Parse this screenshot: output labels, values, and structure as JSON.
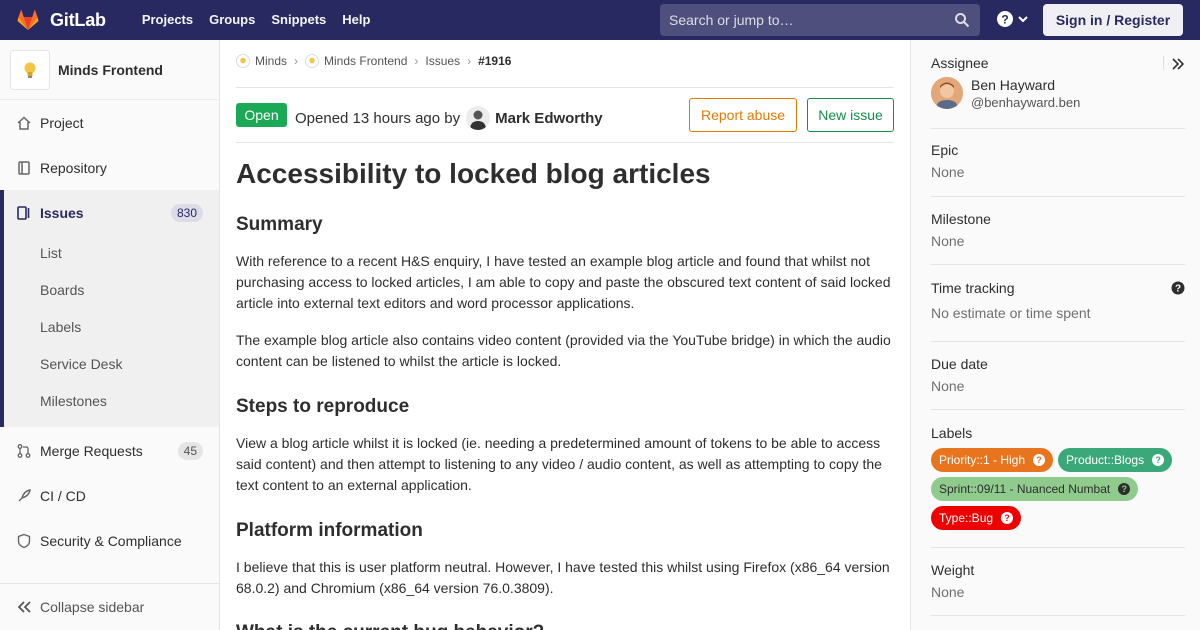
{
  "topbar": {
    "brand": "GitLab",
    "nav": [
      "Projects",
      "Groups",
      "Snippets",
      "Help"
    ],
    "search_placeholder": "Search or jump to…",
    "signin_label": "Sign in / Register",
    "bg_color": "#292961"
  },
  "sidebar": {
    "project_name": "Minds Frontend",
    "items": [
      {
        "label": "Project",
        "icon": "home-icon"
      },
      {
        "label": "Repository",
        "icon": "book-icon"
      },
      {
        "label": "Issues",
        "icon": "issues-icon",
        "count": "830",
        "active": true
      },
      {
        "label": "Merge Requests",
        "icon": "merge-request-icon",
        "count": "45"
      },
      {
        "label": "CI / CD",
        "icon": "rocket-icon"
      },
      {
        "label": "Security & Compliance",
        "icon": "shield-icon"
      }
    ],
    "issues_subitems": [
      "List",
      "Boards",
      "Labels",
      "Service Desk",
      "Milestones"
    ],
    "collapse_label": "Collapse sidebar"
  },
  "breadcrumb": [
    "Minds",
    "Minds Frontend",
    "Issues",
    "#1916"
  ],
  "issue": {
    "status": "Open",
    "opened_text": "Opened 13 hours ago by",
    "author": "Mark Edworthy",
    "report_label": "Report abuse",
    "new_issue_label": "New issue",
    "title": "Accessibility to locked blog articles",
    "sections": [
      {
        "heading": "Summary"
      },
      {
        "heading": "Steps to reproduce"
      },
      {
        "heading": "Platform information"
      },
      {
        "heading": "What is the current bug behavior?"
      }
    ],
    "paragraphs": [
      "With reference to a recent H&S enquiry, I have tested an example blog article and found that whilst not purchasing access to locked articles, I am able to copy and paste the obscured text content of said locked article into external text editors and word processor applications.",
      "The example blog article also contains video content (provided via the YouTube bridge) in which the audio content can be listened to whilst the article is locked.",
      "View a blog article whilst it is locked (ie. needing a predetermined amount of tokens to be able to access said content) and then attempt to listening to any video / audio content, as well as attempting to copy the text content to an external application.",
      "I believe that this is user platform neutral. However, I have tested this whilst using Firefox (x86_64 version 68.0.2) and Chromium (x86_64 version 76.0.3809)."
    ]
  },
  "right": {
    "assignee_title": "Assignee",
    "assignee_name": "Ben Hayward",
    "assignee_handle": "@benhayward.ben",
    "epic_title": "Epic",
    "epic_value": "None",
    "milestone_title": "Milestone",
    "milestone_value": "None",
    "time_title": "Time tracking",
    "time_value": "No estimate or time spent",
    "due_title": "Due date",
    "due_value": "None",
    "labels_title": "Labels",
    "labels": [
      {
        "text": "Priority::1 - High",
        "color": "#e8741e"
      },
      {
        "text": "Product::Blogs",
        "color": "#3aa878"
      },
      {
        "text": "Sprint::09/11 - Nuanced Numbat",
        "color": "#8fcb8c",
        "dark_text": true
      },
      {
        "text": "Type::Bug",
        "color": "#ee0000"
      }
    ],
    "weight_title": "Weight",
    "weight_value": "None"
  }
}
